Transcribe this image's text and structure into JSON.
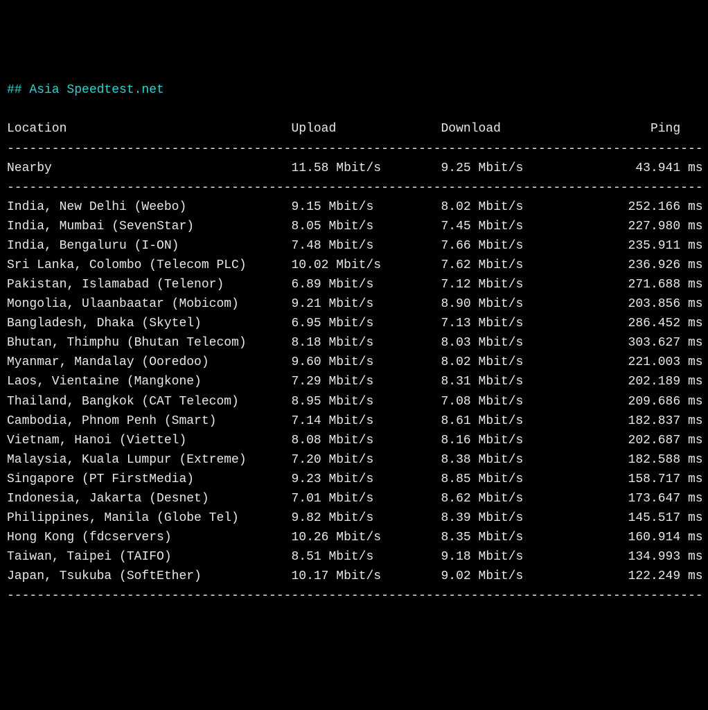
{
  "title_prefix": "## ",
  "title": "Asia Speedtest.net",
  "blank": "",
  "header": {
    "location": "Location",
    "upload": "Upload",
    "download": "Download",
    "ping": "Ping"
  },
  "divider": "---------------------------------------------------------------------------------------------",
  "nearby": {
    "location": "Nearby",
    "upload": "11.58 Mbit/s",
    "download": "9.25 Mbit/s",
    "ping": "43.941 ms"
  },
  "rows": [
    {
      "location": "India, New Delhi (Weebo)",
      "upload": "9.15 Mbit/s",
      "download": "8.02 Mbit/s",
      "ping": "252.166 ms"
    },
    {
      "location": "India, Mumbai (SevenStar)",
      "upload": "8.05 Mbit/s",
      "download": "7.45 Mbit/s",
      "ping": "227.980 ms"
    },
    {
      "location": "India, Bengaluru (I-ON)",
      "upload": "7.48 Mbit/s",
      "download": "7.66 Mbit/s",
      "ping": "235.911 ms"
    },
    {
      "location": "Sri Lanka, Colombo (Telecom PLC)",
      "upload": "10.02 Mbit/s",
      "download": "7.62 Mbit/s",
      "ping": "236.926 ms"
    },
    {
      "location": "Pakistan, Islamabad (Telenor)",
      "upload": "6.89 Mbit/s",
      "download": "7.12 Mbit/s",
      "ping": "271.688 ms"
    },
    {
      "location": "Mongolia, Ulaanbaatar (Mobicom)",
      "upload": "9.21 Mbit/s",
      "download": "8.90 Mbit/s",
      "ping": "203.856 ms"
    },
    {
      "location": "Bangladesh, Dhaka (Skytel)",
      "upload": "6.95 Mbit/s",
      "download": "7.13 Mbit/s",
      "ping": "286.452 ms"
    },
    {
      "location": "Bhutan, Thimphu (Bhutan Telecom)",
      "upload": "8.18 Mbit/s",
      "download": "8.03 Mbit/s",
      "ping": "303.627 ms"
    },
    {
      "location": "Myanmar, Mandalay (Ooredoo)",
      "upload": "9.60 Mbit/s",
      "download": "8.02 Mbit/s",
      "ping": "221.003 ms"
    },
    {
      "location": "Laos, Vientaine (Mangkone)",
      "upload": "7.29 Mbit/s",
      "download": "8.31 Mbit/s",
      "ping": "202.189 ms"
    },
    {
      "location": "Thailand, Bangkok (CAT Telecom)",
      "upload": "8.95 Mbit/s",
      "download": "7.08 Mbit/s",
      "ping": "209.686 ms"
    },
    {
      "location": "Cambodia, Phnom Penh (Smart)",
      "upload": "7.14 Mbit/s",
      "download": "8.61 Mbit/s",
      "ping": "182.837 ms"
    },
    {
      "location": "Vietnam, Hanoi (Viettel)",
      "upload": "8.08 Mbit/s",
      "download": "8.16 Mbit/s",
      "ping": "202.687 ms"
    },
    {
      "location": "Malaysia, Kuala Lumpur (Extreme)",
      "upload": "7.20 Mbit/s",
      "download": "8.38 Mbit/s",
      "ping": "182.588 ms"
    },
    {
      "location": "Singapore (PT FirstMedia)",
      "upload": "9.23 Mbit/s",
      "download": "8.85 Mbit/s",
      "ping": "158.717 ms"
    },
    {
      "location": "Indonesia, Jakarta (Desnet)",
      "upload": "7.01 Mbit/s",
      "download": "8.62 Mbit/s",
      "ping": "173.647 ms"
    },
    {
      "location": "Philippines, Manila (Globe Tel)",
      "upload": "9.82 Mbit/s",
      "download": "8.39 Mbit/s",
      "ping": "145.517 ms"
    },
    {
      "location": "Hong Kong (fdcservers)",
      "upload": "10.26 Mbit/s",
      "download": "8.35 Mbit/s",
      "ping": "160.914 ms"
    },
    {
      "location": "Taiwan, Taipei (TAIFO)",
      "upload": "8.51 Mbit/s",
      "download": "9.18 Mbit/s",
      "ping": "134.993 ms"
    },
    {
      "location": "Japan, Tsukuba (SoftEther)",
      "upload": "10.17 Mbit/s",
      "download": "9.02 Mbit/s",
      "ping": "122.249 ms"
    }
  ]
}
